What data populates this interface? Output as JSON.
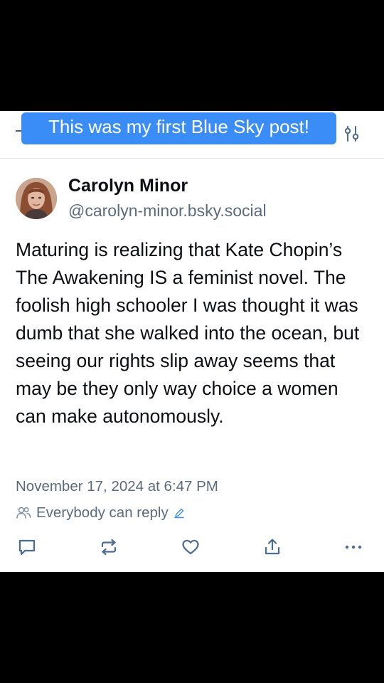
{
  "overlay_caption": "This was my first Blue Sky post!",
  "post": {
    "author_name": "Carolyn Minor",
    "author_handle": "@carolyn-minor.bsky.social",
    "text": "Maturing is realizing that Kate Chopin’s The Awakening IS a feminist novel. The foolish high schooler I was thought it was dumb that she walked into the ocean, but seeing our rights slip away seems that may be they only way choice a women can make autonomously.",
    "timestamp": "November 17, 2024 at 6:47 PM",
    "reply_setting": "Everybody can reply"
  },
  "icons": {
    "filter": "sliders-icon",
    "reply_audience": "people-icon",
    "edit": "pencil-icon",
    "reply": "comment-icon",
    "repost": "repost-icon",
    "like": "heart-icon",
    "share": "share-icon",
    "more": "more-icon"
  },
  "colors": {
    "caption_bg": "#3a8df7",
    "icon": "#4b6b8f",
    "secondary_text": "#5b6b7d"
  }
}
